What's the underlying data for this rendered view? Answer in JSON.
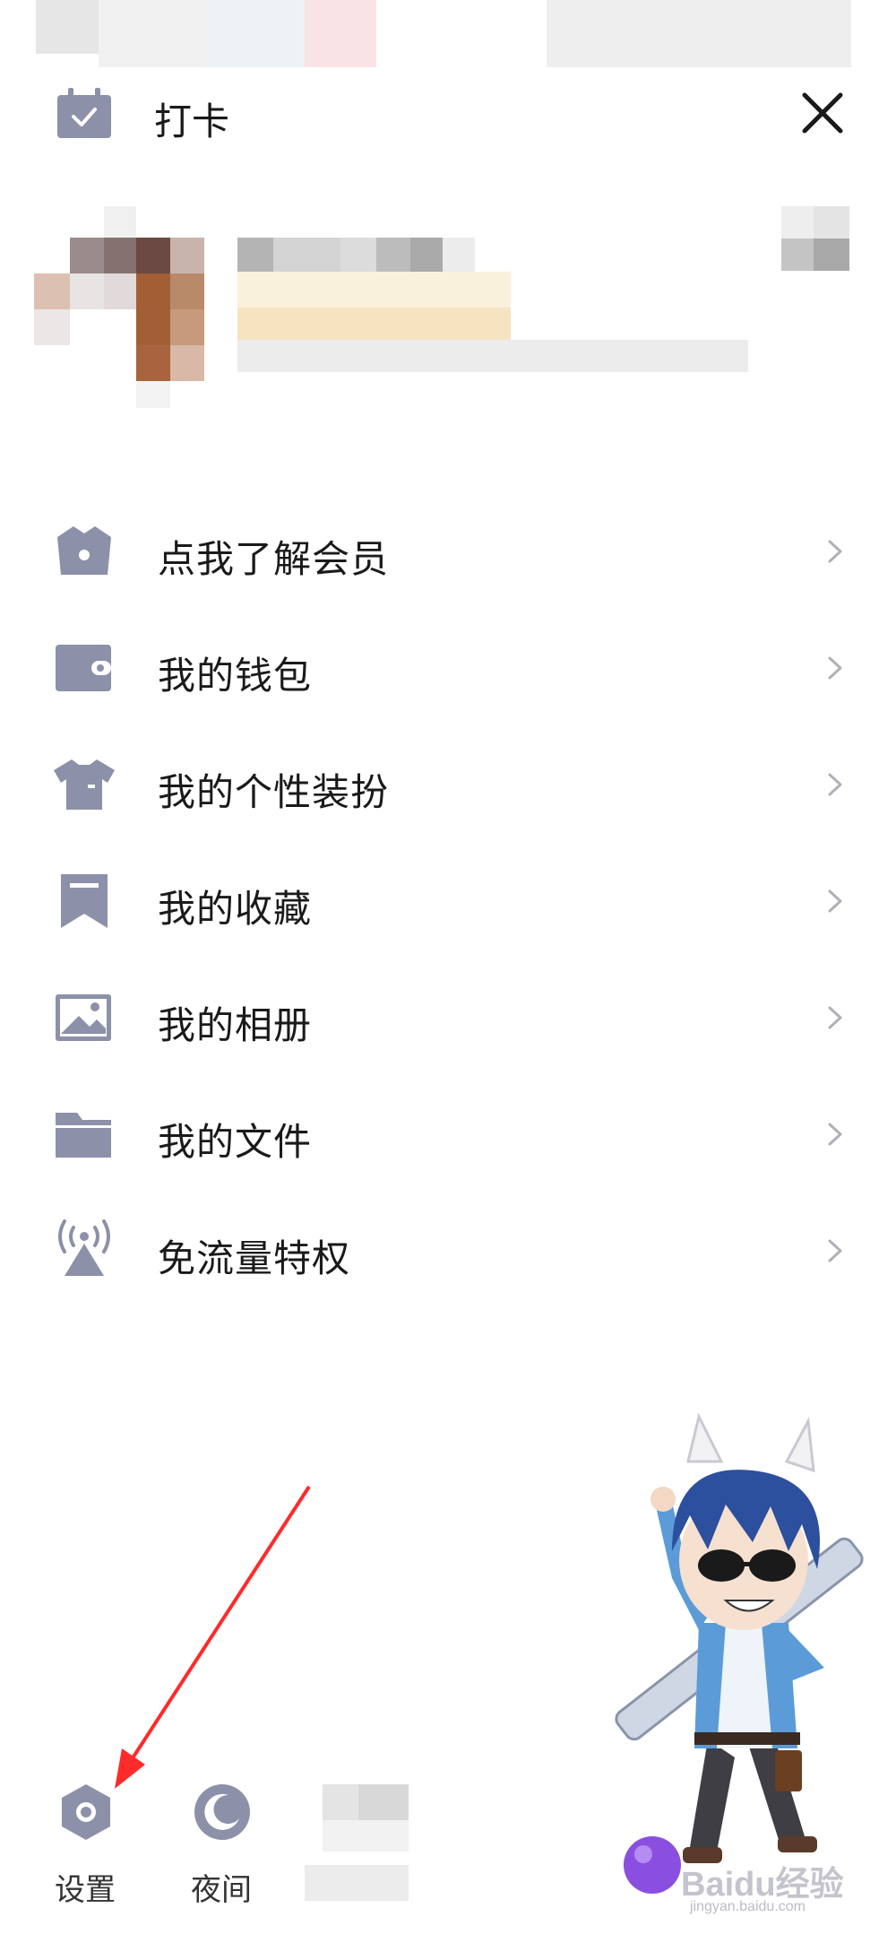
{
  "header": {
    "checkin_label": "打卡",
    "checkin_icon": "calendar-check-icon",
    "close_icon": "close-icon"
  },
  "menu": {
    "items": [
      {
        "label": "点我了解会员",
        "icon": "crown-icon"
      },
      {
        "label": "我的钱包",
        "icon": "wallet-icon"
      },
      {
        "label": "我的个性装扮",
        "icon": "shirt-icon"
      },
      {
        "label": "我的收藏",
        "icon": "bookmark-icon"
      },
      {
        "label": "我的相册",
        "icon": "photo-icon"
      },
      {
        "label": "我的文件",
        "icon": "folder-icon"
      },
      {
        "label": "免流量特权",
        "icon": "signal-tower-icon"
      }
    ]
  },
  "bottom_bar": {
    "settings_label": "设置",
    "night_label": "夜间"
  },
  "watermark": {
    "brand": "Baidu经验",
    "url": "jingyan.baidu.com"
  },
  "colors": {
    "icon_gray": "#8c90a8",
    "arrow_red": "#ff2a2a",
    "text": "#1a1a1a"
  }
}
